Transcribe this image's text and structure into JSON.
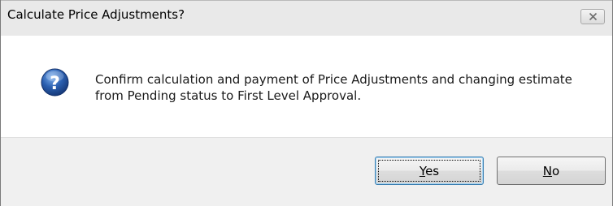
{
  "window": {
    "title": "Calculate Price Adjustments?"
  },
  "dialog": {
    "icon": "question-icon",
    "message": "Confirm calculation and payment of Price Adjustments and changing estimate from Pending status to First Level Approval."
  },
  "buttons": {
    "yes_mnemonic": "Y",
    "yes_rest": "es",
    "no_mnemonic": "N",
    "no_rest": "o"
  },
  "colors": {
    "icon_blue": "#2a5fb0",
    "focus_border": "#3c7fb1",
    "footer_bg": "#f0f0f0",
    "titlebar_bg": "#e9e9e9"
  }
}
